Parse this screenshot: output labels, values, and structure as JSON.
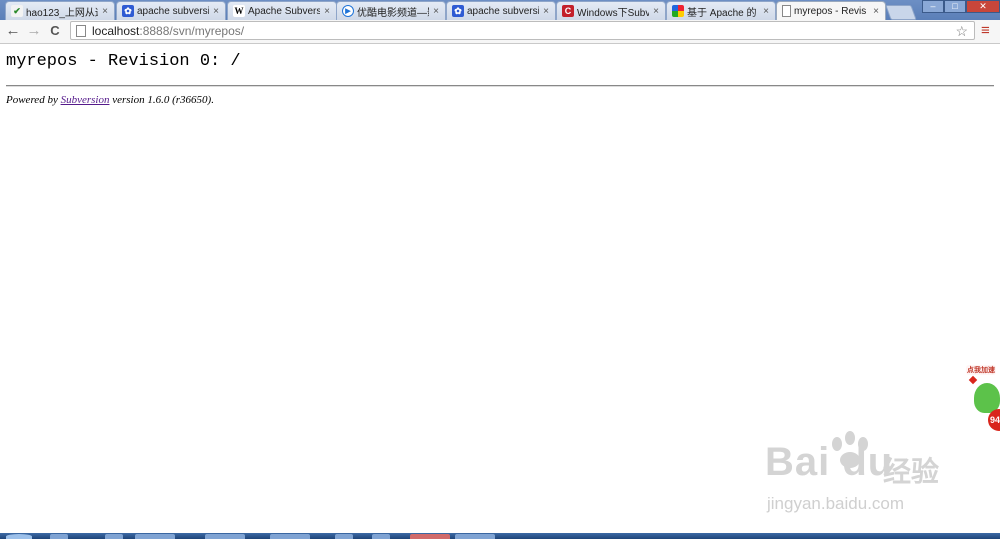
{
  "tabs": [
    {
      "title": "hao123_上网从这",
      "icon": "hao123-icon",
      "active": false
    },
    {
      "title": "apache subversi",
      "icon": "baidu-paw-icon",
      "active": false
    },
    {
      "title": "Apache Subvers",
      "icon": "wikipedia-icon",
      "icon_text": "W",
      "active": false
    },
    {
      "title": "优酷电影频道—影",
      "icon": "youku-play-icon",
      "active": false
    },
    {
      "title": "apache subversi",
      "icon": "baidu-paw-icon",
      "active": false
    },
    {
      "title": "Windows下Subv",
      "icon": "cnblogs-icon",
      "icon_text": "C",
      "active": false
    },
    {
      "title": "基于 Apache 的",
      "icon": "multicolor-grid-icon",
      "active": false
    },
    {
      "title": "myrepos - Revis",
      "icon": "page-icon",
      "active": true
    }
  ],
  "tab_close_glyph": "×",
  "window_controls": {
    "minimize": "‒",
    "maximize": "□",
    "close": "✕"
  },
  "toolbar": {
    "back": "←",
    "forward": "→",
    "reload": "C",
    "address_host": "localhost",
    "address_path": ":8888/svn/myrepos/",
    "star": "☆",
    "menu": "≡"
  },
  "page": {
    "title": "myrepos - Revision 0: /",
    "powered_prefix": "Powered by ",
    "powered_link": "Subversion",
    "powered_suffix": " version 1.6.0 (r36650)."
  },
  "watermark": {
    "logo": "Bai du",
    "chinese": "经验",
    "url": "jingyan.baidu.com"
  },
  "speed_widget": {
    "label": "点我加速",
    "badge": "94"
  },
  "colors": {
    "accent_red": "#d9261c",
    "link_visited": "#551a8b",
    "tabstrip_blue": "#5b7fb8"
  }
}
